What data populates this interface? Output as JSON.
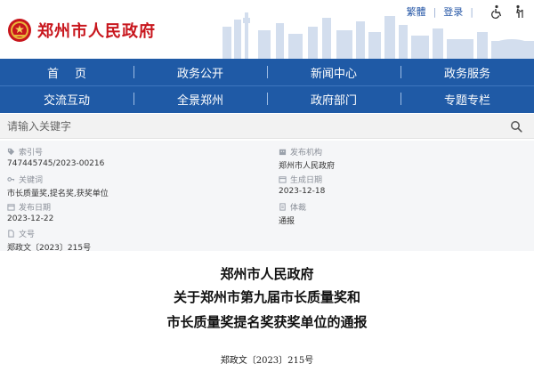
{
  "header": {
    "site_name": "郑州市人民政府",
    "top_links": {
      "traditional": "繁體",
      "login": "登录"
    },
    "icons": {
      "emblem": "national-emblem-icon",
      "accessibility": "wheelchair-icon",
      "elder_mode": "elder-care-icon"
    }
  },
  "nav": {
    "row1": [
      "首页",
      "政务公开",
      "新闻中心",
      "政务服务"
    ],
    "row2": [
      "交流互动",
      "全景郑州",
      "政府部门",
      "专题专栏"
    ]
  },
  "search": {
    "placeholder": "请输入关键字",
    "value": "",
    "icon": "search-icon"
  },
  "meta": {
    "index_no": {
      "label": "索引号",
      "value": "747445745/2023-00216"
    },
    "publisher": {
      "label": "发布机构",
      "value": "郑州市人民政府"
    },
    "keywords": {
      "label": "关键词",
      "value": "市长质量奖,提名奖,获奖单位"
    },
    "created": {
      "label": "生成日期",
      "value": "2023-12-18"
    },
    "published": {
      "label": "发布日期",
      "value": "2023-12-22"
    },
    "genre": {
      "label": "体裁",
      "value": "通报"
    },
    "doc_no": {
      "label": "文号",
      "value": "郑政文〔2023〕215号"
    }
  },
  "document": {
    "title_line1": "郑州市人民政府",
    "title_line2": "关于郑州市第九届市长质量奖和",
    "title_line3": "市长质量奖提名奖获奖单位的通报",
    "number": "郑政文〔2023〕215号"
  },
  "colors": {
    "brand_red": "#c8161d",
    "nav_blue": "#1f5aa6",
    "link_blue": "#2a5aa8"
  }
}
